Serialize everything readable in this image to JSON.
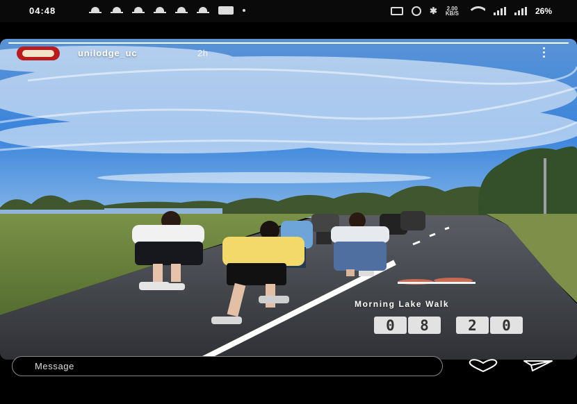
{
  "status_bar": {
    "time": "04:48",
    "notification_icons": [
      "notification-bell-icon",
      "notification-bell-icon",
      "notification-bell-icon",
      "notification-bell-icon",
      "notification-bell-icon",
      "notification-bell-icon",
      "teams-icon",
      "more-notifications-dot"
    ],
    "system_icons": [
      "nfc-icon",
      "alarm-icon",
      "bluetooth-icon",
      "wifi-icon",
      "signal-icon"
    ],
    "network_speed": "2.00",
    "network_speed_unit": "KB/S",
    "battery": "26%"
  },
  "story": {
    "username": "unilodge_uc",
    "time_ago": "2h",
    "progress": 1.0,
    "caption": "Morning Lake Walk",
    "timer_digits": [
      "0",
      "8",
      "2",
      "0"
    ]
  },
  "footer": {
    "message_placeholder": "Message",
    "icons": [
      "heart-icon",
      "send-icon"
    ]
  },
  "colors": {
    "background": "#000000",
    "sky": "#3d86d8",
    "path": "#3b3d42",
    "grass": "#6f8a3a"
  }
}
